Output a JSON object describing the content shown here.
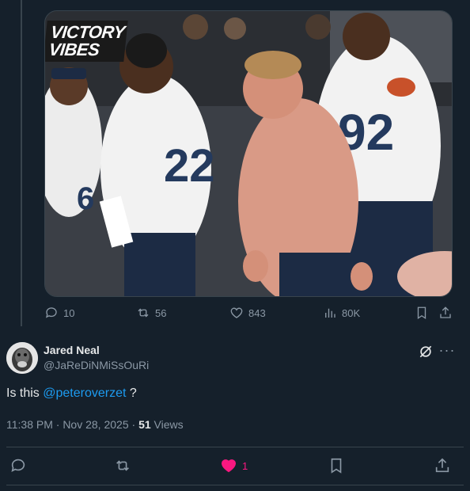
{
  "media": {
    "overlay_text": "VICTORY VIBES",
    "jersey_left_number": "22",
    "jersey_right_number": "92",
    "jersey_far_left_number": "6"
  },
  "parent_actions": {
    "replies": "10",
    "reposts": "56",
    "likes": "843",
    "views": "80K"
  },
  "reply": {
    "author_name": "Jared Neal",
    "author_handle": "@JaReDiNMiSsOuRi",
    "text_prefix": "Is this ",
    "mention": "@peteroverzet",
    "text_suffix": " ?",
    "timestamp": "11:38 PM · Nov 28, 2025 · ",
    "views_count": "51",
    "views_label": " Views"
  },
  "reply_actions": {
    "likes": "1"
  },
  "colors": {
    "background": "#15202b",
    "secondary_text": "#8b98a5",
    "mention": "#1d9bf0",
    "like_active": "#f91880",
    "divider": "#38444d"
  },
  "icons": {
    "reply": "reply-icon",
    "repost": "repost-icon",
    "like": "heart-icon",
    "views": "views-bar-icon",
    "bookmark": "bookmark-icon",
    "share": "share-icon",
    "grok": "grok-icon",
    "more": "more-icon"
  }
}
